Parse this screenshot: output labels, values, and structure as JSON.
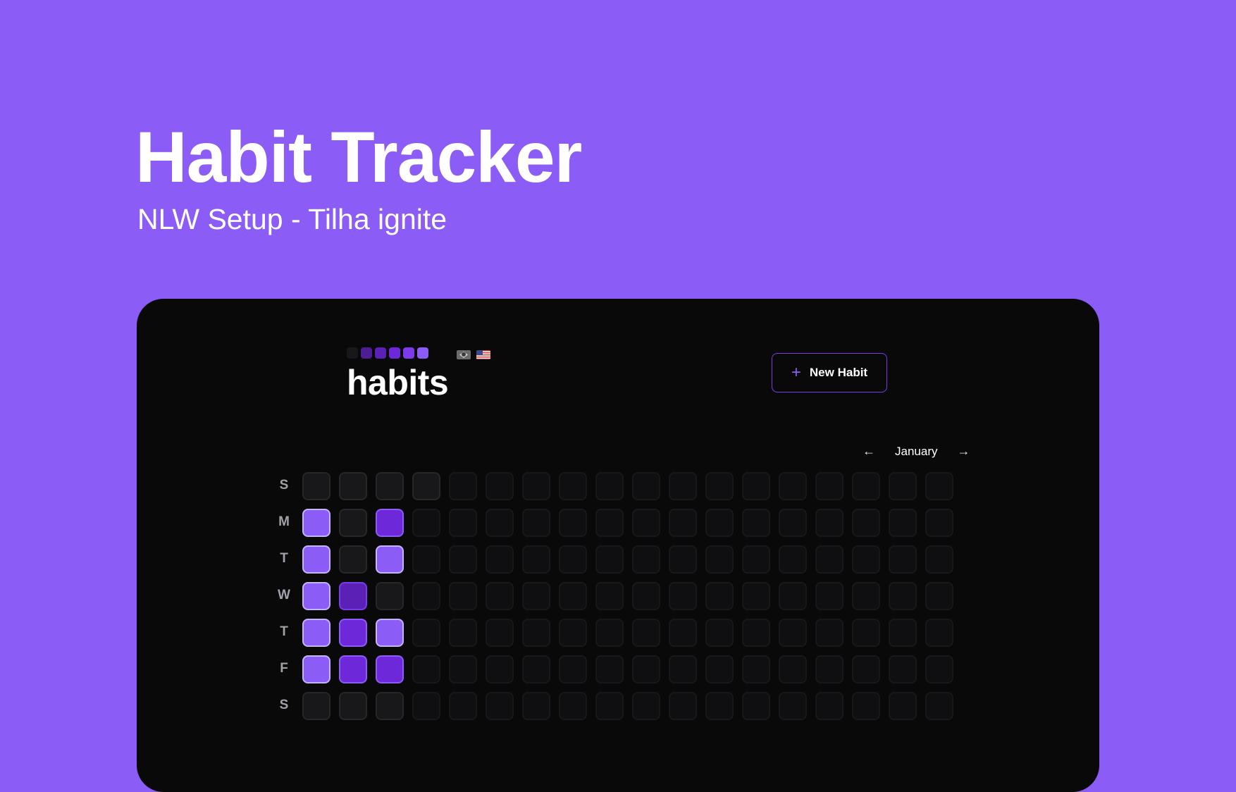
{
  "hero": {
    "title": "Habit Tracker",
    "subtitle": "NLW Setup - Tilha ignite"
  },
  "app": {
    "logo_text": "habits",
    "level_colors": [
      "#18181b",
      "#4c1d95",
      "#5b21b6",
      "#6d28d9",
      "#7c3aed",
      "#8b5cf6"
    ],
    "flags": [
      "brazil-flag-icon",
      "usa-flag-icon"
    ],
    "new_habit_label": "New Habit",
    "new_habit_icon": "plus-icon",
    "month": "January",
    "prev_icon": "arrow-left-icon",
    "next_icon": "arrow-right-icon",
    "week_days": [
      "S",
      "M",
      "T",
      "W",
      "T",
      "F",
      "S"
    ],
    "colors": {
      "background": "#8b5cf6",
      "frame": "#09090a",
      "accent": "#7c3aed",
      "cell_past": "#18181b",
      "cell_future": "#0f0f11"
    },
    "heatmap": {
      "columns": 18,
      "rows": 7,
      "levels": [
        [
          0,
          0,
          0,
          0,
          -1,
          -1,
          -1,
          -1,
          -1,
          -1,
          -1,
          -1,
          -1,
          -1,
          -1,
          -1,
          -1,
          -1
        ],
        [
          5,
          0,
          3,
          -1,
          -1,
          -1,
          -1,
          -1,
          -1,
          -1,
          -1,
          -1,
          -1,
          -1,
          -1,
          -1,
          -1,
          -1
        ],
        [
          5,
          0,
          5,
          -1,
          -1,
          -1,
          -1,
          -1,
          -1,
          -1,
          -1,
          -1,
          -1,
          -1,
          -1,
          -1,
          -1,
          -1
        ],
        [
          5,
          2,
          0,
          -1,
          -1,
          -1,
          -1,
          -1,
          -1,
          -1,
          -1,
          -1,
          -1,
          -1,
          -1,
          -1,
          -1,
          -1
        ],
        [
          5,
          3,
          5,
          -1,
          -1,
          -1,
          -1,
          -1,
          -1,
          -1,
          -1,
          -1,
          -1,
          -1,
          -1,
          -1,
          -1,
          -1
        ],
        [
          5,
          3,
          3,
          -1,
          -1,
          -1,
          -1,
          -1,
          -1,
          -1,
          -1,
          -1,
          -1,
          -1,
          -1,
          -1,
          -1,
          -1
        ],
        [
          0,
          0,
          0,
          -1,
          -1,
          -1,
          -1,
          -1,
          -1,
          -1,
          -1,
          -1,
          -1,
          -1,
          -1,
          -1,
          -1,
          -1
        ]
      ],
      "level_legend": {
        "-1": "future day",
        "0": "no progress",
        "1": "level 1",
        "2": "level 2",
        "3": "level 3",
        "4": "level 4",
        "5": "level 5"
      }
    }
  }
}
